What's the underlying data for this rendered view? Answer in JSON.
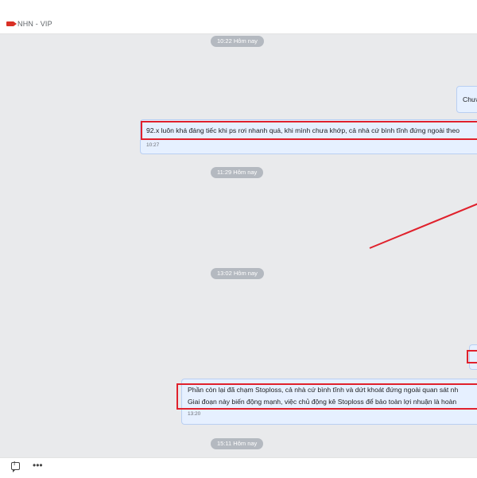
{
  "header": {
    "title": "NHN - VIP",
    "tag_color": "#d93025"
  },
  "timestamps": {
    "t1": "10:22 Hôm nay",
    "t2": "11:29 Hôm nay",
    "t3": "13:02 Hôm nay",
    "t4": "15:11 Hôm nay"
  },
  "messages": [
    {
      "text": "Chưa"
    },
    {
      "text": "92.x luôn khá đáng tiếc khi ps rơi nhanh quá, khi mình chưa khớp, cả nhà cứ bình tĩnh đứng ngoài theo",
      "time": "10:27"
    },
    {
      "line1": "Phần còn lại đã chạm Stoploss, cả nhà cứ bình tĩnh và dứt khoát đứng ngoài quan sát nh",
      "line2": "Giai đoạn này biến động mạnh, việc chủ động kê Stoploss để bảo toàn lợi nhuận là hoàn",
      "time": "13:20"
    }
  ],
  "annotation_color": "#e0212c",
  "bottom": {
    "quote_icon": "quote-icon",
    "more_icon": "more-icon",
    "more_glyph": "•••"
  }
}
